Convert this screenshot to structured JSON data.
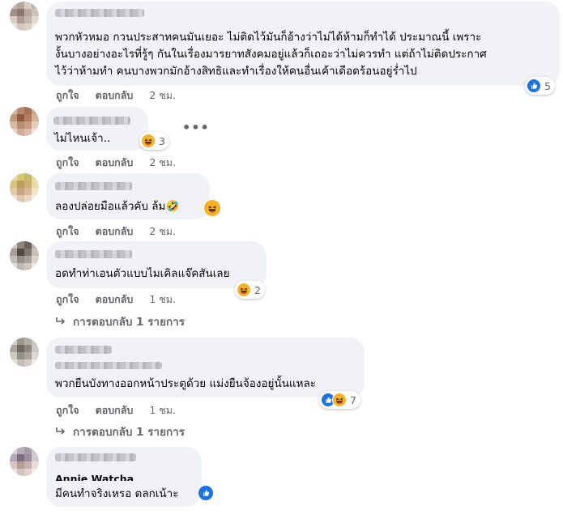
{
  "comments": [
    {
      "author": "",
      "text_lines": [
        "พวกหัวหมอ กวนประสาทคนมันเยอะ ไม่ติดไว้มันก็อ้างว่าไม่ได้ห้ามก็ทำได้ ประมาณนี้ เพราะ",
        "งั้นบางอย่างอะไรที่รู้ๆ กันในเรื่องมารยาทสังคมอยู่แล้วก็เถอะว่าไม่ควรทำ แต่ถ้าไม่ติดประกาศ",
        "ไว้ว่าห้ามทำ คนบางพวกมักอ้างสิทธิและทำเรื่องให้คนอื่นเค้าเดือดร้อนอยู่ร่ำไป"
      ],
      "like_label": "ถูกใจ",
      "reply_label": "ตอบกลับ",
      "time": "2 ชม.",
      "reactions": {
        "icons": [
          "like-icon"
        ],
        "count": "5"
      }
    },
    {
      "author": "",
      "text_lines": [
        "ไม่ไหนเจ้า.."
      ],
      "like_label": "ถูกใจ",
      "reply_label": "ตอบกลับ",
      "time": "2 ชม.",
      "reactions": {
        "icons": [
          "haha-icon"
        ],
        "count": "3"
      },
      "more_label": "•••"
    },
    {
      "author": "",
      "text_lines": [
        "ลองปล่อยมือแล้วคับ ล้ม🤣"
      ],
      "like_label": "ถูกใจ",
      "reply_label": "ตอบกลับ",
      "time": "2 ชม.",
      "reactions": {
        "icons": [
          "haha-icon"
        ],
        "count": ""
      }
    },
    {
      "author": "",
      "text_lines": [
        "อดทำท่าเอนตัวแบบไมเคิลแจ๊คสันเลย"
      ],
      "like_label": "ถูกใจ",
      "reply_label": "ตอบกลับ",
      "time": "1 ชม.",
      "reactions": {
        "icons": [
          "haha-icon"
        ],
        "count": "2"
      },
      "replies_label": "การตอบกลับ 1 รายการ"
    },
    {
      "author": "",
      "text_lines": [
        "พวกยืนบังทางออกหน้าประตูด้วย แม่งยืนจ้องอยู่นั้นแหละ"
      ],
      "like_label": "ถูกใจ",
      "reply_label": "ตอบกลับ",
      "time": "1 ชม.",
      "reactions": {
        "icons": [
          "like-icon",
          "haha-icon"
        ],
        "count": "7"
      },
      "replies_label": "การตอบกลับ 1 รายการ"
    },
    {
      "author": "Annie Watcha",
      "text_lines": [
        "มีคนทำจริงเหรอ ตลกเน้าะ"
      ],
      "reactions": {
        "icons": [
          "like-icon"
        ],
        "count": ""
      }
    }
  ],
  "colors": {
    "bubble": "#f0f2f5",
    "meta": "#65676b",
    "like": "#1b74e4",
    "haha": "#f7b125"
  }
}
